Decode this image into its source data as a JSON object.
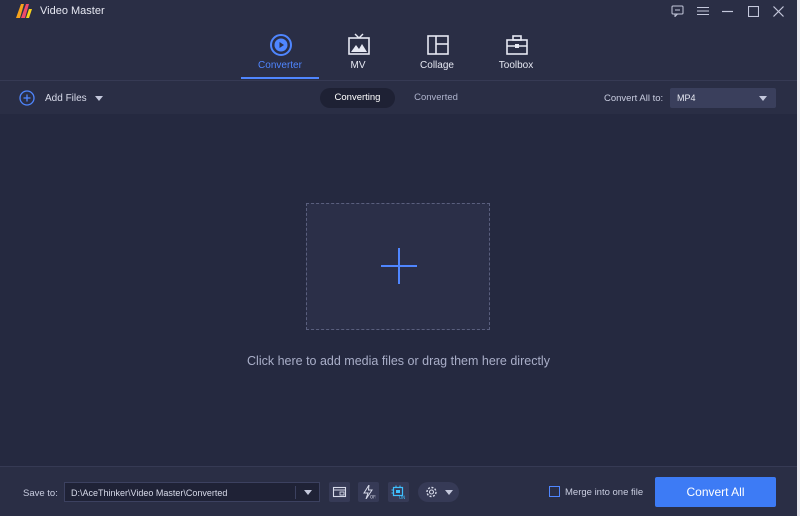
{
  "app": {
    "title": "Video Master"
  },
  "window_controls": [
    "feedback-icon",
    "menu-icon",
    "minimize-icon",
    "maximize-icon",
    "close-icon"
  ],
  "nav": {
    "active": "Converter",
    "items": [
      {
        "label": "Converter",
        "icon": "converter-icon"
      },
      {
        "label": "MV",
        "icon": "mv-icon"
      },
      {
        "label": "Collage",
        "icon": "collage-icon"
      },
      {
        "label": "Toolbox",
        "icon": "toolbox-icon"
      }
    ]
  },
  "toolbar": {
    "add_files_label": "Add Files",
    "tabs": [
      {
        "label": "Converting",
        "active": true
      },
      {
        "label": "Converted",
        "active": false
      }
    ],
    "convert_all_to_label": "Convert All to:",
    "format_value": "MP4"
  },
  "main": {
    "drop_hint": "Click here to add media files or drag them here directly"
  },
  "bottom": {
    "save_to_label": "Save to:",
    "save_path": "D:\\AceThinker\\Video Master\\Converted",
    "merge_label": "Merge into one file",
    "merge_checked": false,
    "convert_all_label": "Convert All",
    "tool_icons": [
      "open-folder-icon",
      "hardware-accel-icon",
      "gpu-on-icon",
      "settings-gear-icon"
    ]
  },
  "colors": {
    "accent": "#4f86ff",
    "button": "#3d7bf5",
    "background": "#2a2e45",
    "panel": "#252940"
  }
}
